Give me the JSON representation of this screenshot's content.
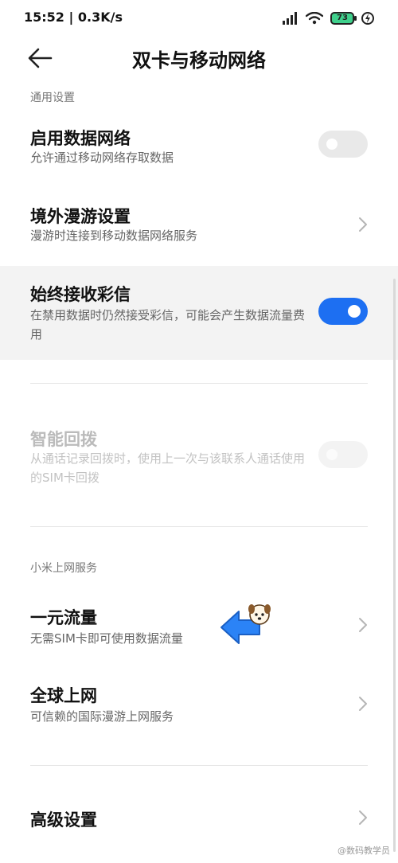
{
  "status_bar": {
    "time": "15:52 | 0.3K/s",
    "battery": "73",
    "icons": [
      "signal-icon",
      "wifi-icon",
      "battery-icon",
      "charging-icon"
    ]
  },
  "header": {
    "title": "双卡与移动网络",
    "back_icon": "back-arrow-icon"
  },
  "sections": {
    "general": "通用设置",
    "xiaomi": "小米上网服务"
  },
  "rows": {
    "mobile_data": {
      "title": "启用数据网络",
      "subtitle": "允许通过移动网络存取数据",
      "toggle": "off"
    },
    "roaming": {
      "title": "境外漫游设置",
      "subtitle": "漫游时连接到移动数据网络服务"
    },
    "mms": {
      "title": "始终接收彩信",
      "subtitle": "在禁用数据时仍然接受彩信，可能会产生数据流量费用",
      "toggle": "on"
    },
    "smart_redial": {
      "title": "智能回拨",
      "subtitle": "从通话记录回拨时，使用上一次与该联系人通话使用的SIM卡回拨",
      "toggle": "off-disabled"
    },
    "one_yuan": {
      "title": "一元流量",
      "subtitle": "无需SIM卡即可使用数据流量"
    },
    "global": {
      "title": "全球上网",
      "subtitle": "可信赖的国际漫游上网服务"
    },
    "advanced": {
      "title": "高级设置"
    }
  },
  "colors": {
    "accent": "#1d6ff2",
    "background": "#ffffff",
    "highlight_row": "#f3f3f3",
    "pointer_arrow": "#2b83f6"
  },
  "watermark": "@数码教学员"
}
